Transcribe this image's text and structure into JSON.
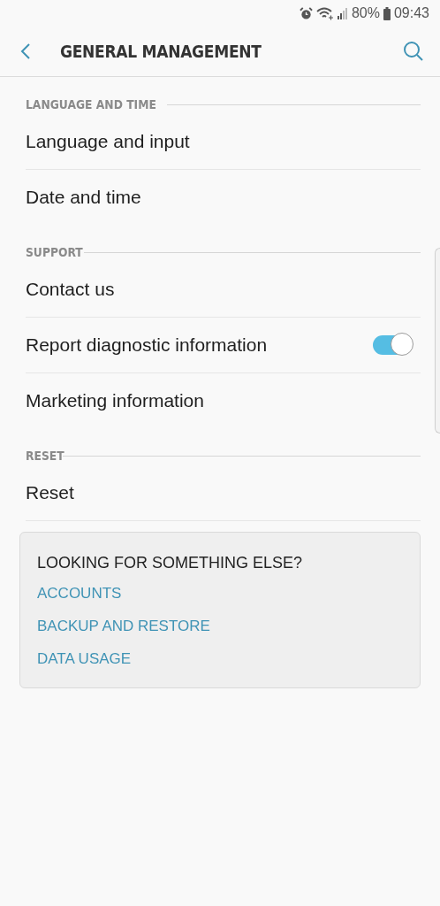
{
  "status_bar": {
    "battery": "80%",
    "time": "09:43"
  },
  "header": {
    "title": "GENERAL MANAGEMENT"
  },
  "sections": [
    {
      "title": "LANGUAGE AND TIME",
      "items": [
        {
          "label": "Language and input",
          "kind": "plain"
        },
        {
          "label": "Date and time",
          "kind": "plain"
        }
      ]
    },
    {
      "title": "SUPPORT",
      "items": [
        {
          "label": "Contact us",
          "kind": "plain"
        },
        {
          "label": "Report diagnostic information",
          "kind": "switch",
          "on": true
        },
        {
          "label": "Marketing information",
          "kind": "plain"
        }
      ]
    },
    {
      "title": "RESET",
      "items": [
        {
          "label": "Reset",
          "kind": "plain"
        }
      ]
    }
  ],
  "suggestions": {
    "title": "LOOKING FOR SOMETHING ELSE?",
    "links": [
      "ACCOUNTS",
      "BACKUP AND RESTORE",
      "DATA USAGE"
    ]
  }
}
